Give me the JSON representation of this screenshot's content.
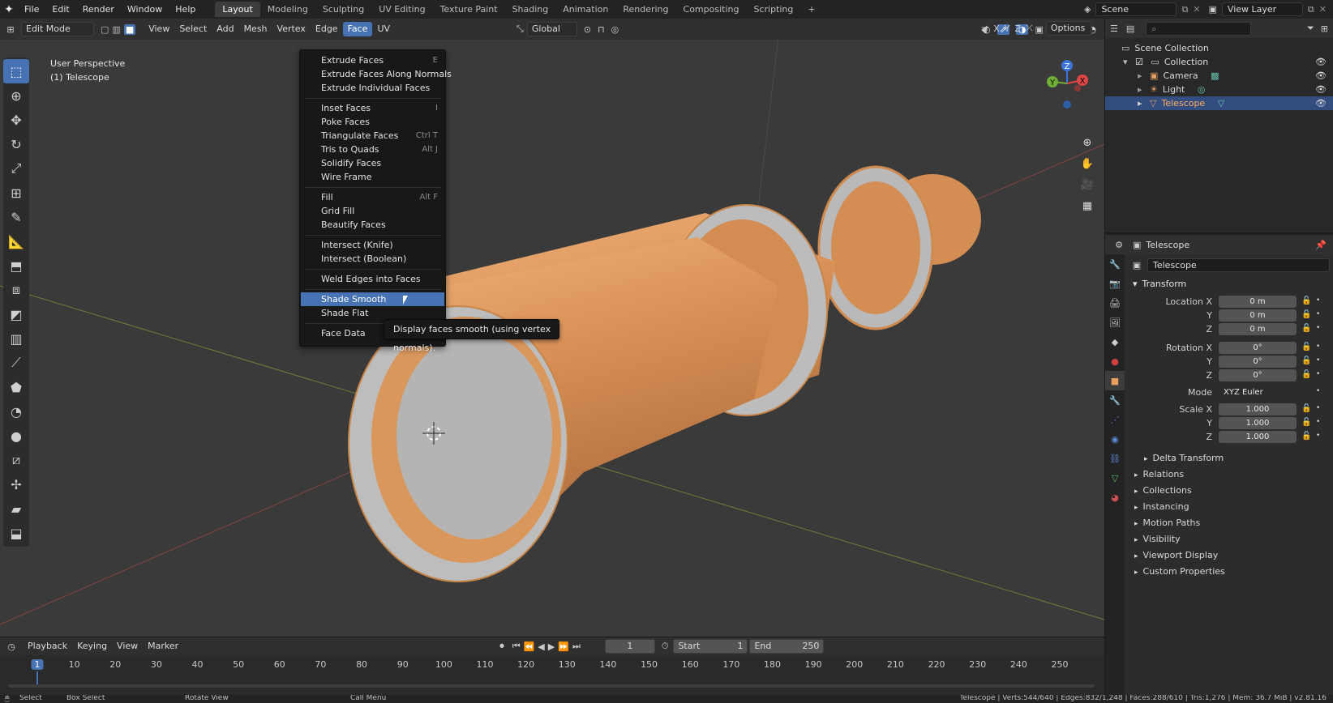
{
  "top_menu": [
    "File",
    "Edit",
    "Render",
    "Window",
    "Help"
  ],
  "workspace_tabs": [
    "Layout",
    "Modeling",
    "Sculpting",
    "UV Editing",
    "Texture Paint",
    "Shading",
    "Animation",
    "Rendering",
    "Compositing",
    "Scripting"
  ],
  "active_workspace": "Layout",
  "scene_field": "Scene",
  "view_layer_field": "View Layer",
  "viewport": {
    "mode": "Edit Mode",
    "menus": [
      "View",
      "Select",
      "Add",
      "Mesh",
      "Vertex",
      "Edge",
      "Face",
      "UV"
    ],
    "active_menu": "Face",
    "orientation": "Global",
    "options_label": "Options",
    "axis_x": "X",
    "axis_y": "Y",
    "axis_z": "Z",
    "overlay_line1": "User Perspective",
    "overlay_line2": "(1) Telescope"
  },
  "face_menu": {
    "items": [
      {
        "label": "Extrude Faces",
        "shortcut": "E"
      },
      {
        "label": "Extrude Faces Along Normals",
        "shortcut": ""
      },
      {
        "label": "Extrude Individual Faces",
        "shortcut": ""
      },
      {
        "label": "Inset Faces",
        "shortcut": "I"
      },
      {
        "label": "Poke Faces",
        "shortcut": ""
      },
      {
        "label": "Triangulate Faces",
        "shortcut": "Ctrl T"
      },
      {
        "label": "Tris to Quads",
        "shortcut": "Alt J"
      },
      {
        "label": "Solidify Faces",
        "shortcut": ""
      },
      {
        "label": "Wire Frame",
        "shortcut": ""
      },
      {
        "label": "Fill",
        "shortcut": "Alt F"
      },
      {
        "label": "Grid Fill",
        "shortcut": ""
      },
      {
        "label": "Beautify Faces",
        "shortcut": ""
      },
      {
        "label": "Intersect (Knife)",
        "shortcut": ""
      },
      {
        "label": "Intersect (Boolean)",
        "shortcut": ""
      },
      {
        "label": "Weld Edges into Faces",
        "shortcut": ""
      },
      {
        "label": "Shade Smooth",
        "shortcut": ""
      },
      {
        "label": "Shade Flat",
        "shortcut": ""
      },
      {
        "label": "Face Data",
        "shortcut": ""
      }
    ],
    "highlighted": "Shade Smooth",
    "tooltip": "Display faces smooth (using vertex normals)."
  },
  "outliner": {
    "root": "Scene Collection",
    "collection": "Collection",
    "objects": [
      "Camera",
      "Light",
      "Telescope"
    ],
    "selected": "Telescope"
  },
  "properties": {
    "header_object": "Telescope",
    "name_field": "Telescope",
    "transform_label": "Transform",
    "location": {
      "label": "Location X",
      "x": "0 m",
      "y": "0 m",
      "z": "0 m"
    },
    "rotation": {
      "label": "Rotation X",
      "x": "0°",
      "y": "0°",
      "z": "0°"
    },
    "mode_label": "Mode",
    "mode_value": "XYZ Euler",
    "scale": {
      "label": "Scale X",
      "x": "1.000",
      "y": "1.000",
      "z": "1.000"
    },
    "y_label": "Y",
    "z_label": "Z",
    "delta_transform": "Delta Transform",
    "panels": [
      "Relations",
      "Collections",
      "Instancing",
      "Motion Paths",
      "Visibility",
      "Viewport Display",
      "Custom Properties"
    ]
  },
  "timeline": {
    "menus": [
      "Playback",
      "Keying",
      "View",
      "Marker"
    ],
    "current_frame": "1",
    "start_label": "Start",
    "start_value": "1",
    "end_label": "End",
    "end_value": "250",
    "ticks": [
      "1",
      "10",
      "20",
      "30",
      "40",
      "50",
      "60",
      "70",
      "80",
      "90",
      "100",
      "110",
      "120",
      "130",
      "140",
      "150",
      "160",
      "170",
      "180",
      "190",
      "200",
      "210",
      "220",
      "230",
      "240",
      "250"
    ]
  },
  "statusbar": {
    "left1": "Select",
    "left2": "Box Select",
    "left3": "Rotate View",
    "left4": "Call Menu",
    "stats": "Telescope | Verts:544/640 | Edges:832/1,248 | Faces:288/610 | Tris:1,276 | Mem: 36.7 MiB | v2.81.16"
  },
  "colors": {
    "accent": "#4772b3",
    "object_orange": "#e8a060",
    "viewport_bg": "#3a3a3a"
  }
}
